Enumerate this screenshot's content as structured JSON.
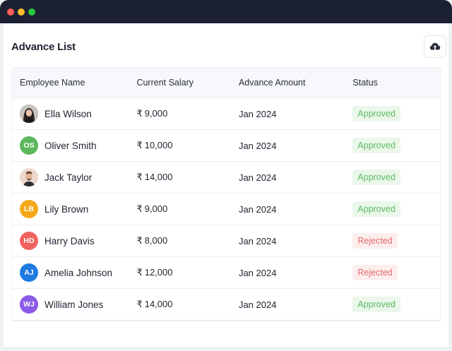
{
  "page": {
    "title": "Advance List",
    "upload_icon": "cloud-upload-icon"
  },
  "table": {
    "headers": [
      "Employee Name",
      "Current Salary",
      "Advance Amount",
      "Status"
    ],
    "rows": [
      {
        "name": "Ella Wilson",
        "avatar_type": "photo",
        "initials": "",
        "avatar_color": "#3a3a3a",
        "salary": "9,000",
        "advance": "Jan 2024",
        "status": "Approved",
        "status_kind": "approved"
      },
      {
        "name": "Oliver Smith",
        "avatar_type": "initials",
        "initials": "OS",
        "avatar_color": "#5cb85c",
        "salary": "10,000",
        "advance": "Jan 2024",
        "status": "Approved",
        "status_kind": "approved"
      },
      {
        "name": "Jack Taylor",
        "avatar_type": "photo",
        "initials": "",
        "avatar_color": "#d9b9a8",
        "salary": "14,000",
        "advance": "Jan 2024",
        "status": "Approved",
        "status_kind": "approved"
      },
      {
        "name": "Lily Brown",
        "avatar_type": "initials",
        "initials": "LB",
        "avatar_color": "#f5a91a",
        "salary": "9,000",
        "advance": "Jan 2024",
        "status": "Approved",
        "status_kind": "approved"
      },
      {
        "name": "Harry Davis",
        "avatar_type": "initials",
        "initials": "HD",
        "avatar_color": "#f0625e",
        "salary": "8,000",
        "advance": "Jan 2024",
        "status": "Rejected",
        "status_kind": "rejected"
      },
      {
        "name": "Amelia Johnson",
        "avatar_type": "initials",
        "initials": "AJ",
        "avatar_color": "#1f7ae0",
        "salary": "12,000",
        "advance": "Jan 2024",
        "status": "Rejected",
        "status_kind": "rejected"
      },
      {
        "name": "William Jones",
        "avatar_type": "initials",
        "initials": "WJ",
        "avatar_color": "#8b5be8",
        "salary": "14,000",
        "advance": "Jan 2024",
        "status": "Approved",
        "status_kind": "approved"
      }
    ]
  },
  "currency_symbol": "₹"
}
